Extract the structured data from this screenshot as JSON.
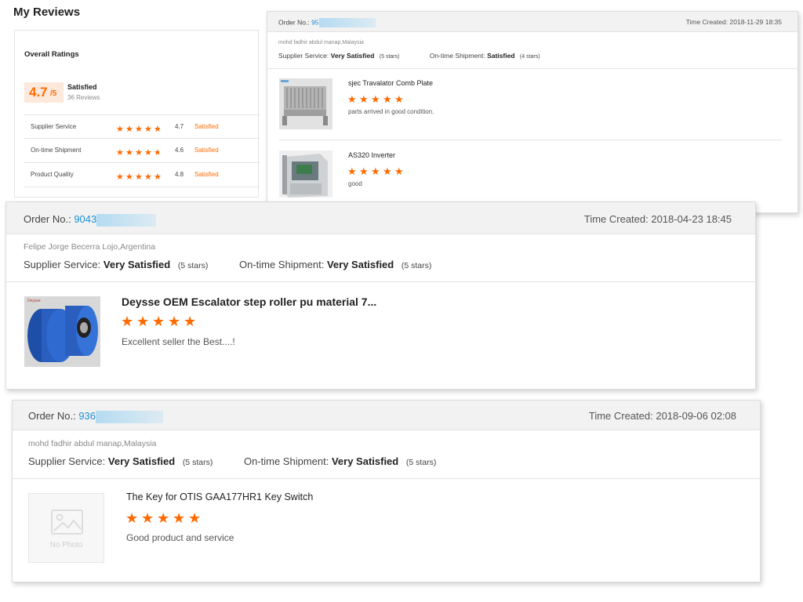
{
  "page": {
    "title": "My Reviews"
  },
  "overall": {
    "heading": "Overall Ratings",
    "score": "4.7",
    "score_max": "/5",
    "status": "Satisfied",
    "reviews": "36 Reviews",
    "rows": [
      {
        "label": "Supplier Service",
        "value": "4.7",
        "status": "Satisfied",
        "stars": 4.7
      },
      {
        "label": "On-time Shipment",
        "value": "4.6",
        "status": "Satisfied",
        "stars": 4.6
      },
      {
        "label": "Product Quality",
        "value": "4.8",
        "status": "Satisfied",
        "stars": 4.8
      }
    ]
  },
  "review1": {
    "order_label": "Order No.:",
    "order_no": "95",
    "time": "Time Created: 2018-11-29 18:35",
    "reviewer": "mohd fadhir abdul manap,Malaysia",
    "supplier_label": "Supplier Service:",
    "supplier_value": "Very Satisfied",
    "supplier_stars": "(5 stars)",
    "shipment_label": "On-time Shipment:",
    "shipment_value": "Satisfied",
    "shipment_stars": "(4 stars)",
    "items": [
      {
        "title": "sjec Travalator Comb Plate",
        "comment": "parts arrived in good condition.",
        "stars": 5
      },
      {
        "title": "AS320 Inverter",
        "comment": "good",
        "stars": 5
      }
    ]
  },
  "review2": {
    "order_label": "Order No.:",
    "order_no": "9043",
    "time": "Time Created: 2018-04-23 18:45",
    "reviewer": "Felipe Jorge Becerra Lojo,Argentina",
    "supplier_label": "Supplier Service:",
    "supplier_value": "Very Satisfied",
    "supplier_stars": "(5 stars)",
    "shipment_label": "On-time Shipment:",
    "shipment_value": "Very Satisfied",
    "shipment_stars": "(5 stars)",
    "item": {
      "title": "Deysse OEM Escalator step roller pu material 7...",
      "comment": "Excellent seller the Best....!",
      "stars": 5
    }
  },
  "review3": {
    "order_label": "Order No.:",
    "order_no": "936",
    "time": "Time Created: 2018-09-06 02:08",
    "reviewer": "mohd fadhir abdul manap,Malaysia",
    "supplier_label": "Supplier Service:",
    "supplier_value": "Very Satisfied",
    "supplier_stars": "(5 stars)",
    "shipment_label": "On-time Shipment:",
    "shipment_value": "Very Satisfied",
    "shipment_stars": "(5 stars)",
    "item": {
      "title": "The Key for OTIS GAA177HR1 Key Switch",
      "comment": "Good product and service",
      "stars": 5,
      "no_photo": "No Photo"
    }
  },
  "colors": {
    "accent": "#ff6a00",
    "link": "#1a8fd6",
    "score_bg": "#fde9dc"
  }
}
